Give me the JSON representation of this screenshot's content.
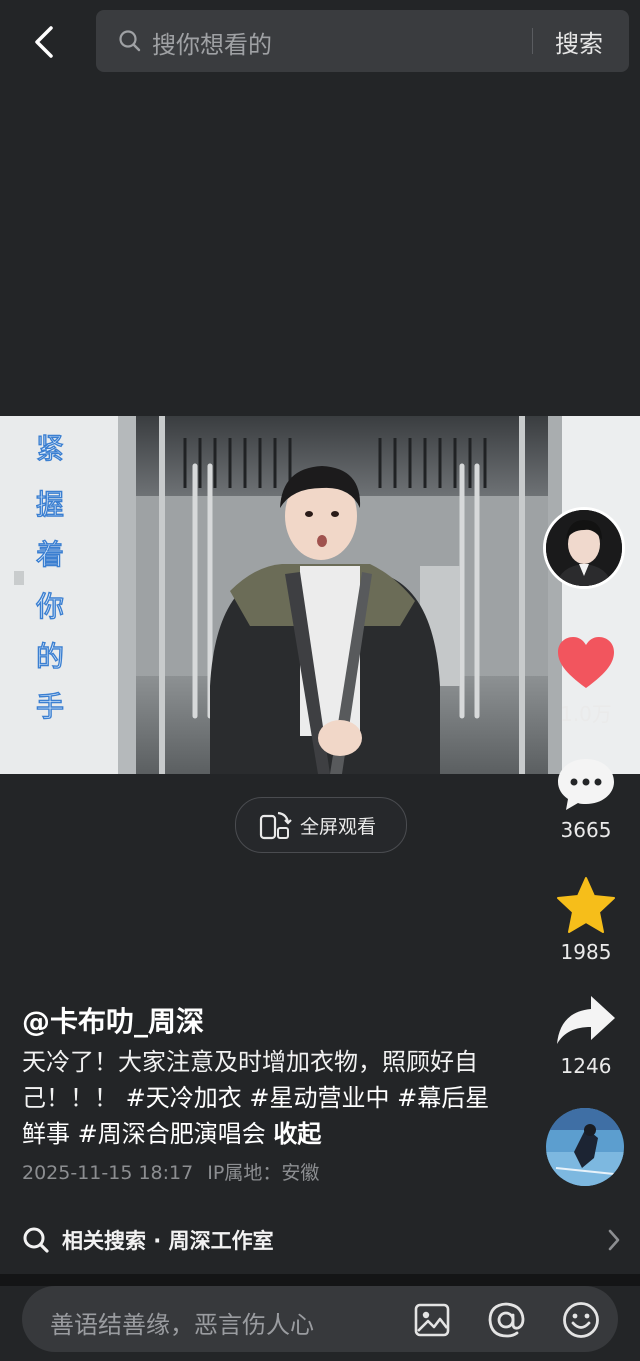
{
  "search": {
    "placeholder": "搜你想看的",
    "button": "搜索"
  },
  "video": {
    "overlay_text": "紧握着你的手",
    "fullscreen_label": "全屏观看"
  },
  "rail": {
    "likes": "1.0万",
    "comments": "3665",
    "favorites": "1985",
    "shares": "1246"
  },
  "post": {
    "author": "@卡布叻_周深",
    "text": "天冷了！大家注意及时增加衣物，照顾好自己！！！",
    "hashtags": [
      "#天冷加衣",
      "#星动营业中",
      "#幕后星鲜事",
      "#周深合肥演唱会"
    ],
    "collapse": "收起",
    "timestamp": "2025-11-15 18:17",
    "ip": "IP属地：安徽"
  },
  "related": {
    "label": "相关搜索 · 周深工作室"
  },
  "comment_bar": {
    "placeholder": "善语结善缘，恶言伤人心"
  },
  "colors": {
    "like": "#f2555e",
    "favorite": "#f6be1a",
    "background": "#232527"
  }
}
